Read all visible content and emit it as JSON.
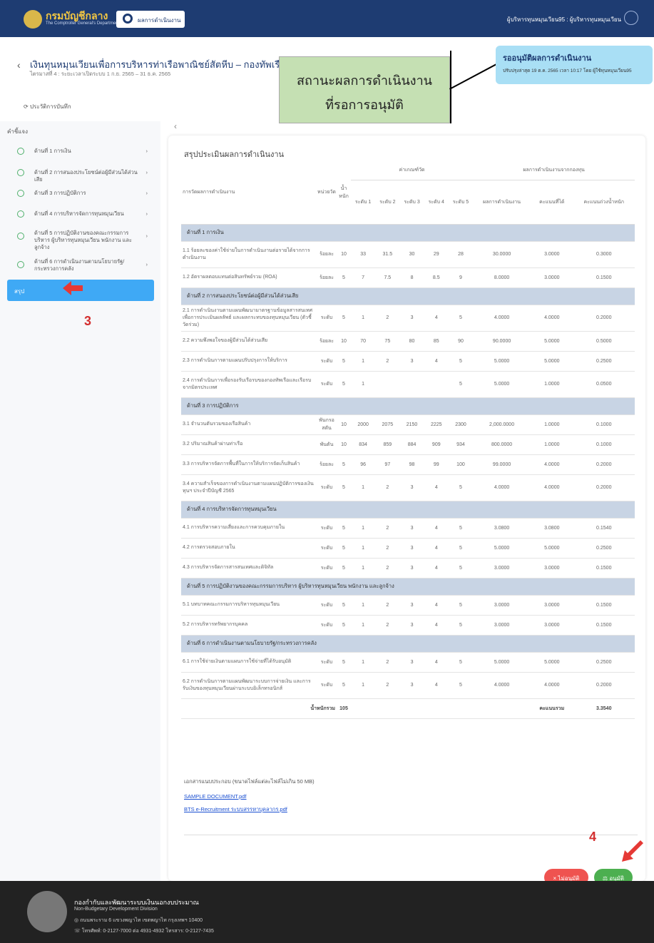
{
  "topbar": {
    "brand": "กรมบัญชีกลาง",
    "brand_sub": "The Comptroller General's Department",
    "tab": "ผลการดำเนินงาน",
    "user": "ผู้บริหารทุนหมุนเวียน95 : ผู้บริหารทุนหมุนเวียน"
  },
  "header": {
    "title": "เงินทุนหมุนเวียนเพื่อการบริหารท่าเรือพาณิชย์สัตหีบ – กองทัพเรือ",
    "subtitle": "ไตรมาสที่ 4 : ระยะเวลาเปิดระบบ 1 ก.ย. 2565 – 31 ธ.ค. 2565",
    "history": "ประวัติการบันทึก"
  },
  "annotation": {
    "line1": "สถานะผลการดำเนินงาน",
    "line2": "ที่รอการอนุมัติ"
  },
  "status": {
    "title": "รออนุมัติผลการดำเนินงาน",
    "detail": "ปรับปรุงล่าสุด 19 ต.ค. 2565 เวลา 10:17 โดย ผู้ใช้ทุนหมุนเวียน95"
  },
  "sidebar": {
    "title": "คำชี้แจง",
    "items": [
      {
        "label": "ด้านที่ 1 การเงิน"
      },
      {
        "label": "ด้านที่ 2 การสนองประโยชน์ต่อผู้มีส่วนได้ส่วนเสีย"
      },
      {
        "label": "ด้านที่ 3 การปฏิบัติการ"
      },
      {
        "label": "ด้านที่ 4 การบริหารจัดการทุนหมุนเวียน"
      },
      {
        "label": "ด้านที่ 5 การปฏิบัติงานของคณะกรรมการบริหาร ผู้บริหารทุนหมุนเวียน พนักงาน และลูกจ้าง"
      },
      {
        "label": "ด้านที่ 6 การดำเนินงานตามนโยบายรัฐ/กระทรวงการคลัง"
      }
    ],
    "active": "สรุป",
    "step3": "3",
    "step4": "4"
  },
  "main": {
    "title": "สรุปประเมินผลการดำเนินงาน",
    "headers": {
      "kpi": "การวัดผลการดำเนินงาน",
      "unit": "หน่วยวัด",
      "weight": "น้ำหนัก",
      "criteria": "ค่าเกณฑ์วัด",
      "results": "ผลการดำเนินงานจากกองทุน",
      "l1": "ระดับ 1",
      "l2": "ระดับ 2",
      "l3": "ระดับ 3",
      "l4": "ระดับ 4",
      "l5": "ระดับ 5",
      "perf": "ผลการดำเนินงาน",
      "score": "คะแนนที่ได้",
      "wscore": "คะแนนถ่วงน้ำหนัก"
    },
    "rows": [
      {
        "cat": "ด้านที่ 1 การเงิน"
      },
      {
        "d": "1.1 ร้อยละของค่าใช้จ่ายในการดำเนินงานต่อรายได้จากการดำเนินงาน",
        "u": "ร้อยละ",
        "w": "10",
        "l": [
          "33",
          "31.5",
          "30",
          "29",
          "28"
        ],
        "p": "30.0000",
        "s": "3.0000",
        "ws": "0.3000"
      },
      {
        "d": "1.2 อัตราผลตอบแทนต่อสินทรัพย์รวม (ROA)",
        "u": "ร้อยละ",
        "w": "5",
        "l": [
          "7",
          "7.5",
          "8",
          "8.5",
          "9"
        ],
        "p": "8.0000",
        "s": "3.0000",
        "ws": "0.1500"
      },
      {
        "cat": "ด้านที่ 2 การสนองประโยชน์ต่อผู้มีส่วนได้ส่วนเสีย"
      },
      {
        "d": "2.1 การดำเนินงานตามแผนพัฒนามาตรฐานข้อมูลสารสนเทศเพื่อการประเมินผลลัพธ์ และผลกระทบของทุนหมุนเวียน (ตัวชี้วัดร่วม)",
        "u": "ระดับ",
        "w": "5",
        "l": [
          "1",
          "2",
          "3",
          "4",
          "5"
        ],
        "p": "4.0000",
        "s": "4.0000",
        "ws": "0.2000"
      },
      {
        "d": "2.2 ความพึงพอใจของผู้มีส่วนได้ส่วนเสีย",
        "u": "ร้อยละ",
        "w": "10",
        "l": [
          "70",
          "75",
          "80",
          "85",
          "90"
        ],
        "p": "90.0000",
        "s": "5.0000",
        "ws": "0.5000"
      },
      {
        "d": "2.3 การดำเนินการตามแผนปรับปรุงการให้บริการ",
        "u": "ระดับ",
        "w": "5",
        "l": [
          "1",
          "2",
          "3",
          "4",
          "5"
        ],
        "p": "5.0000",
        "s": "5.0000",
        "ws": "0.2500"
      },
      {
        "d": "2.4 การดำเนินการเพื่อรองรับเรือรบของกองทัพเรือและเรือรบจากมิตรประเทศ",
        "u": "ระดับ",
        "w": "5",
        "l": [
          "1",
          "",
          "",
          "",
          "5"
        ],
        "p": "5.0000",
        "s": "1.0000",
        "ws": "0.0500"
      },
      {
        "cat": "ด้านที่ 3 การปฏิบัติการ"
      },
      {
        "d": "3.1 จำนวนตันรวมของเรือสินค้า",
        "u": "พันกรอสตัน",
        "w": "10",
        "l": [
          "2000",
          "2075",
          "2150",
          "2225",
          "2300"
        ],
        "p": "2,000.0000",
        "s": "1.0000",
        "ws": "0.1000"
      },
      {
        "d": "3.2 ปริมาณสินค้าผ่านท่าเรือ",
        "u": "พันตัน",
        "w": "10",
        "l": [
          "834",
          "859",
          "884",
          "909",
          "934"
        ],
        "p": "800.0000",
        "s": "1.0000",
        "ws": "0.1000"
      },
      {
        "d": "3.3 การบริหารจัดการพื้นที่ในการให้บริการจัดเก็บสินค้า",
        "u": "ร้อยละ",
        "w": "5",
        "l": [
          "96",
          "97",
          "98",
          "99",
          "100"
        ],
        "p": "99.0000",
        "s": "4.0000",
        "ws": "0.2000"
      },
      {
        "d": "3.4 ความสำเร็จของการดำเนินงานตามแผนปฏิบัติการของเงินทุนฯ ประจำปีบัญชี 2565",
        "u": "ระดับ",
        "w": "5",
        "l": [
          "1",
          "2",
          "3",
          "4",
          "5"
        ],
        "p": "4.0000",
        "s": "4.0000",
        "ws": "0.2000"
      },
      {
        "cat": "ด้านที่ 4 การบริหารจัดการทุนหมุนเวียน"
      },
      {
        "d": "4.1 การบริหารความเสี่ยงและการควบคุมภายใน",
        "u": "ระดับ",
        "w": "5",
        "l": [
          "1",
          "2",
          "3",
          "4",
          "5"
        ],
        "p": "3.0800",
        "s": "3.0800",
        "ws": "0.1540"
      },
      {
        "d": "4.2 การตรวจสอบภายใน",
        "u": "ระดับ",
        "w": "5",
        "l": [
          "1",
          "2",
          "3",
          "4",
          "5"
        ],
        "p": "5.0000",
        "s": "5.0000",
        "ws": "0.2500"
      },
      {
        "d": "4.3 การบริหารจัดการสารสนเทศและดิจิทัล",
        "u": "ระดับ",
        "w": "5",
        "l": [
          "1",
          "2",
          "3",
          "4",
          "5"
        ],
        "p": "3.0000",
        "s": "3.0000",
        "ws": "0.1500"
      },
      {
        "cat": "ด้านที่ 5 การปฏิบัติงานของคณะกรรมการบริหาร ผู้บริหารทุนหมุนเวียน พนักงาน และลูกจ้าง"
      },
      {
        "d": "5.1 บทบาทคณะกรรมการบริหารทุนหมุนเวียน",
        "u": "ระดับ",
        "w": "5",
        "l": [
          "1",
          "2",
          "3",
          "4",
          "5"
        ],
        "p": "3.0000",
        "s": "3.0000",
        "ws": "0.1500"
      },
      {
        "d": "5.2 การบริหารทรัพยากรบุคคล",
        "u": "ระดับ",
        "w": "5",
        "l": [
          "1",
          "2",
          "3",
          "4",
          "5"
        ],
        "p": "3.0000",
        "s": "3.0000",
        "ws": "0.1500"
      },
      {
        "cat": "ด้านที่ 6 การดำเนินงานตามนโยบายรัฐ/กระทรวงการคลัง"
      },
      {
        "d": "6.1 การใช้จ่ายเงินตามแผนการใช้จ่ายที่ได้รับอนุมัติ",
        "u": "ระดับ",
        "w": "5",
        "l": [
          "1",
          "2",
          "3",
          "4",
          "5"
        ],
        "p": "5.0000",
        "s": "5.0000",
        "ws": "0.2500"
      },
      {
        "d": "6.2 การดำเนินการตามแผนพัฒนาระบบการจ่ายเงิน และการรับเงินของทุนหมุนเวียนผ่านระบบอิเล็กทรอนิกส์",
        "u": "ระดับ",
        "w": "5",
        "l": [
          "1",
          "2",
          "3",
          "4",
          "5"
        ],
        "p": "4.0000",
        "s": "4.0000",
        "ws": "0.2000"
      }
    ],
    "total_weight_label": "น้ำหนักรวม",
    "total_weight": "105",
    "total_score_label": "คะแนนรวม",
    "total_score": "3.3540",
    "attach_title": "เอกสารแนบประกอบ (ขนาดไฟล์แต่ละไฟล์ไม่เกิน 50 MB)",
    "files": [
      "SAMPLE DOCUMENT.pdf",
      "BTS e-Recruitment ระบบสรรหาบุคลากร.pdf"
    ],
    "reject": "× ไม่อนุมัติ",
    "approve": "⚖ อนุมัติ"
  },
  "footer": {
    "org": "กองกำกับและพัฒนาระบบเงินนอกงบประมาณ",
    "org_en": "Non-Budgetary Development Division",
    "address": "ถนนพระราม 6 แขวงพญาไท เขตพญาไท กรุงเทพฯ 10400",
    "phone": "โทรศัพท์: 0-2127-7000 ต่อ 4931-4932 โทรสาร: 0-2127-7435"
  }
}
